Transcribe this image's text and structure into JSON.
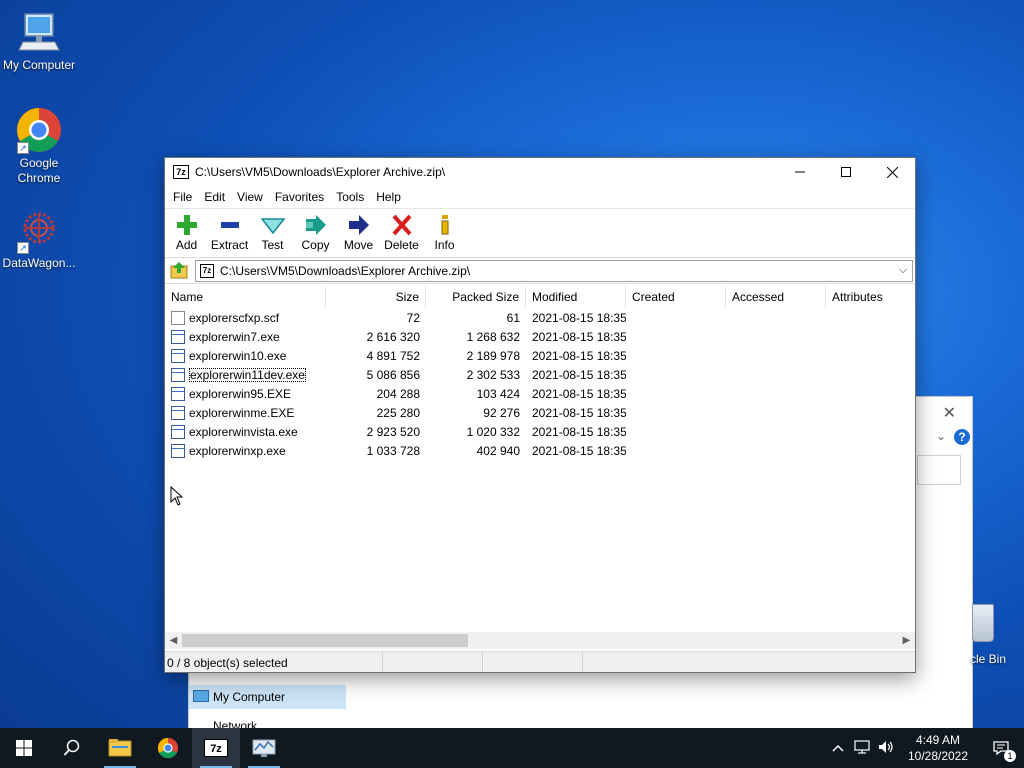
{
  "desktop": {
    "icons": [
      {
        "label": "My Computer"
      },
      {
        "label": "Google Chrome"
      },
      {
        "label": "DataWagon..."
      }
    ],
    "recycle_label": "cle Bin"
  },
  "bg_window": {
    "nav_selected": "My Computer",
    "nav_next": "Network",
    "help_label": "?"
  },
  "window": {
    "title": "C:\\Users\\VM5\\Downloads\\Explorer Archive.zip\\",
    "app_badge": "7z",
    "menu": [
      "File",
      "Edit",
      "View",
      "Favorites",
      "Tools",
      "Help"
    ],
    "toolbar": [
      "Add",
      "Extract",
      "Test",
      "Copy",
      "Move",
      "Delete",
      "Info"
    ],
    "address": "C:\\Users\\VM5\\Downloads\\Explorer Archive.zip\\",
    "columns": [
      "Name",
      "Size",
      "Packed Size",
      "Modified",
      "Created",
      "Accessed",
      "Attributes"
    ],
    "files": [
      {
        "name": "explorerscfxp.scf",
        "size": "72",
        "packed": "61",
        "modified": "2021-08-15 18:35",
        "type": "scf"
      },
      {
        "name": "explorerwin7.exe",
        "size": "2 616 320",
        "packed": "1 268 632",
        "modified": "2021-08-15 18:35",
        "type": "exe"
      },
      {
        "name": "explorerwin10.exe",
        "size": "4 891 752",
        "packed": "2 189 978",
        "modified": "2021-08-15 18:35",
        "type": "exe"
      },
      {
        "name": "explorerwin11dev.exe",
        "size": "5 086 856",
        "packed": "2 302 533",
        "modified": "2021-08-15 18:35",
        "type": "exe",
        "focused": true
      },
      {
        "name": "explorerwin95.EXE",
        "size": "204 288",
        "packed": "103 424",
        "modified": "2021-08-15 18:35",
        "type": "exe"
      },
      {
        "name": "explorerwinme.EXE",
        "size": "225 280",
        "packed": "92 276",
        "modified": "2021-08-15 18:35",
        "type": "exe"
      },
      {
        "name": "explorerwinvista.exe",
        "size": "2 923 520",
        "packed": "1 020 332",
        "modified": "2021-08-15 18:35",
        "type": "exe"
      },
      {
        "name": "explorerwinxp.exe",
        "size": "1 033 728",
        "packed": "402 940",
        "modified": "2021-08-15 18:35",
        "type": "exe"
      }
    ],
    "status": "0 / 8 object(s) selected"
  },
  "taskbar": {
    "app_7z_label": "7z",
    "time": "4:49 AM",
    "date": "10/28/2022",
    "notif_count": "1"
  },
  "colors": {
    "accent": "#0078d7",
    "add_green": "#2ea82e",
    "extract_blue": "#1d3fa8",
    "delete_red": "#d81e1e",
    "taskbar": "#101820"
  }
}
